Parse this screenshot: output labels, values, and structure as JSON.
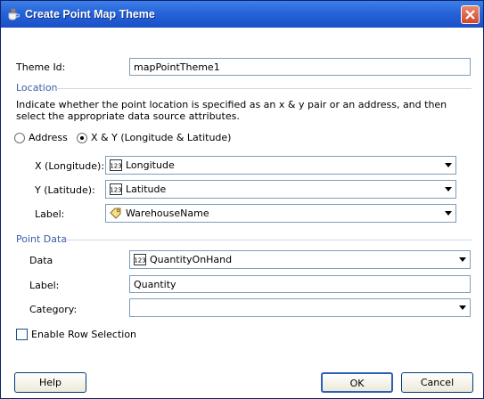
{
  "window": {
    "title": "Create Point Map Theme"
  },
  "theme_id": {
    "label": "Theme Id:",
    "value": "mapPointTheme1"
  },
  "location": {
    "section_title": "Location",
    "description": "Indicate whether the point location is specified as an x & y pair or an address, and then select the appropriate data source attributes.",
    "radio_address": "Address",
    "radio_xy": "X & Y (Longitude & Latitude)",
    "x_label": "X (Longitude):",
    "x_value": "Longitude",
    "y_label": "Y (Latitude):",
    "y_value": "Latitude",
    "label_label": "Label:",
    "label_value": "WarehouseName"
  },
  "point_data": {
    "section_title": "Point Data",
    "data_label": "Data",
    "data_value": "QuantityOnHand",
    "label_label": "Label:",
    "label_value": "Quantity",
    "category_label": "Category:",
    "category_value": ""
  },
  "enable_row_selection": "Enable Row Selection",
  "buttons": {
    "help": "Help",
    "ok": "OK",
    "cancel": "Cancel"
  },
  "icons": {
    "x_type": "number-type-icon",
    "y_type": "number-type-icon",
    "label_type": "tag-icon",
    "data_type": "number-type-icon"
  }
}
